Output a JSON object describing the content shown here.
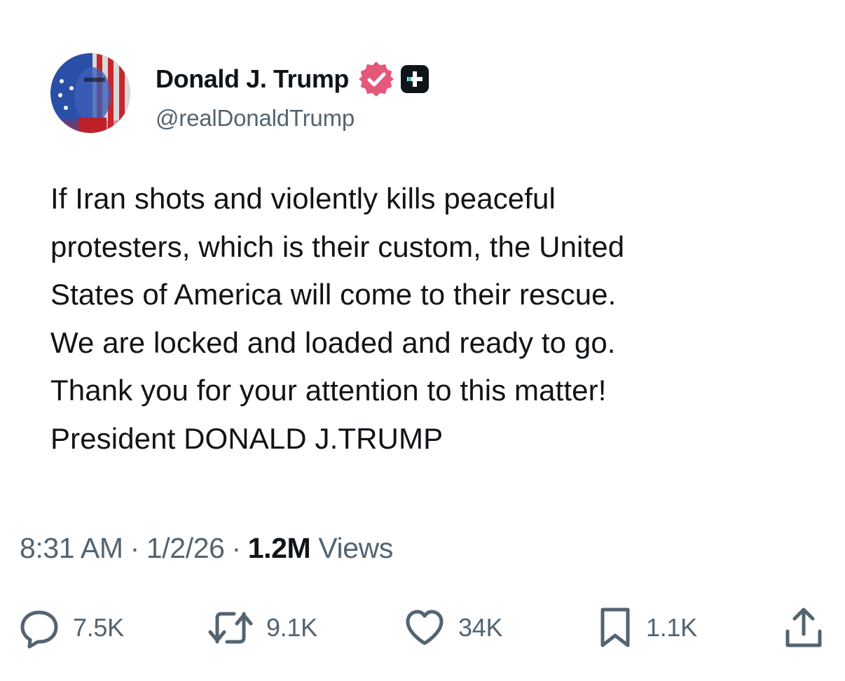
{
  "post": {
    "author": {
      "display_name": "Donald J. Trump",
      "handle": "@realDonaldTrump",
      "verified_icon": "verified-badge-icon",
      "subscriber_icon": "plus-badge-icon",
      "verified_color": "#e4587a"
    },
    "body_lines": [
      "If Iran shots and violently kills peaceful",
      "protesters, which is their custom, the United",
      "States of America will come to their rescue.",
      "We are locked and loaded and ready to go.",
      "Thank you for your attention to this matter!",
      "President DONALD J.TRUMP"
    ],
    "meta": {
      "time": "8:31 AM",
      "separator": "·",
      "date": "1/2/26",
      "views_count": "1.2M",
      "views_label": "Views"
    },
    "actions": {
      "reply": {
        "icon": "reply-icon",
        "count": "7.5K"
      },
      "retweet": {
        "icon": "retweet-icon",
        "count": "9.1K"
      },
      "like": {
        "icon": "heart-icon",
        "count": "34K"
      },
      "bookmark": {
        "icon": "bookmark-icon",
        "count": "1.1K"
      },
      "share": {
        "icon": "share-icon"
      }
    }
  }
}
